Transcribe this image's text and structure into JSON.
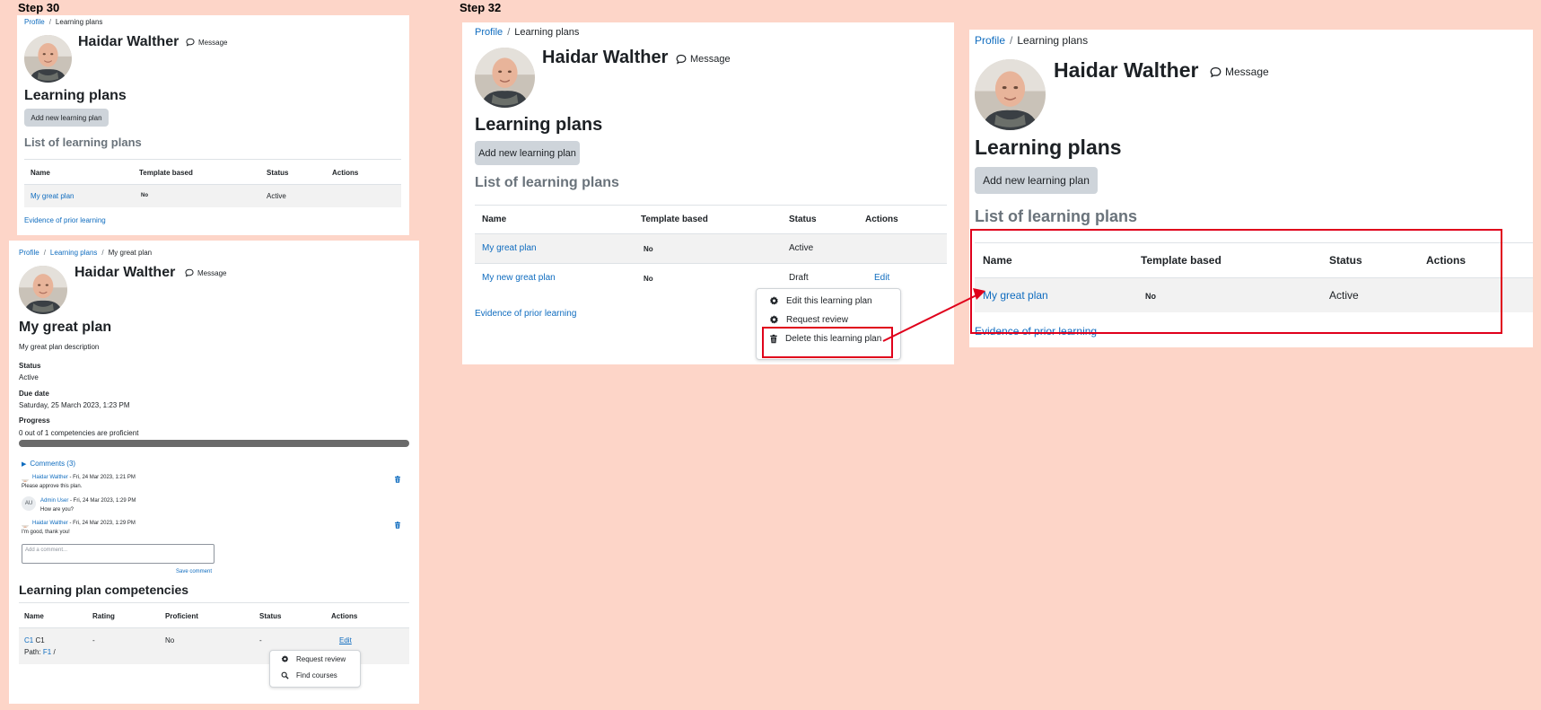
{
  "step_labels": {
    "left": "Step 30",
    "right": "Step 32"
  },
  "user": {
    "name": "Haidar Walther",
    "message_label": "Message"
  },
  "breadcrumbs": {
    "profile": "Profile",
    "learning_plans": "Learning plans",
    "current_plan": "My great plan"
  },
  "plans_page": {
    "title": "Learning plans",
    "add_button": "Add new learning plan",
    "list_heading": "List of learning plans",
    "columns": [
      "Name",
      "Template based",
      "Status",
      "Actions"
    ],
    "rows": [
      {
        "name": "My great plan",
        "template": "No",
        "status": "Active",
        "action": ""
      },
      {
        "name": "My new great plan",
        "template": "No",
        "status": "Draft",
        "action": "Edit"
      }
    ],
    "evidence_link": "Evidence of prior learning",
    "actions_menu": [
      "Edit this learning plan",
      "Request review",
      "Delete this learning plan"
    ]
  },
  "plan_detail": {
    "title": "My great plan",
    "description": "My great plan description",
    "status_label": "Status",
    "status_value": "Active",
    "due_label": "Due date",
    "due_value": "Saturday, 25 March 2023, 1:23 PM",
    "progress_label": "Progress",
    "progress_text": "0 out of 1 competencies are proficient",
    "progress_fraction": 0,
    "comments_toggle": "Comments (3)",
    "comments": [
      {
        "author": "Haidar Walther",
        "date": " - Fri, 24 Mar 2023, 1:21 PM",
        "text": "Please approve this plan."
      },
      {
        "author": "Admin User",
        "date": " - Fri, 24 Mar 2023, 1:29 PM",
        "text": "How are you?",
        "initials": "AU"
      },
      {
        "author": "Haidar Walther",
        "date": " - Fri, 24 Mar 2023, 1:29 PM",
        "text": "I'm good, thank you!"
      }
    ],
    "comment_placeholder": "Add a comment...",
    "save_comment": "Save comment",
    "competencies_heading": "Learning plan competencies",
    "comp_columns": [
      "Name",
      "Rating",
      "Proficient",
      "Status",
      "Actions"
    ],
    "comp_row": {
      "code": "C1",
      "name": " C1",
      "path_label": "Path: ",
      "path_link": "F1",
      "path_tail": " /",
      "rating": "-",
      "proficient": "No",
      "status": "-",
      "action": "Edit"
    },
    "comp_menu": [
      "Request review",
      "Find courses"
    ]
  },
  "colors": {
    "background": "#fdd5c8",
    "link": "#0f6cbf",
    "highlight": "#e0001b",
    "button": "#ced4da"
  }
}
